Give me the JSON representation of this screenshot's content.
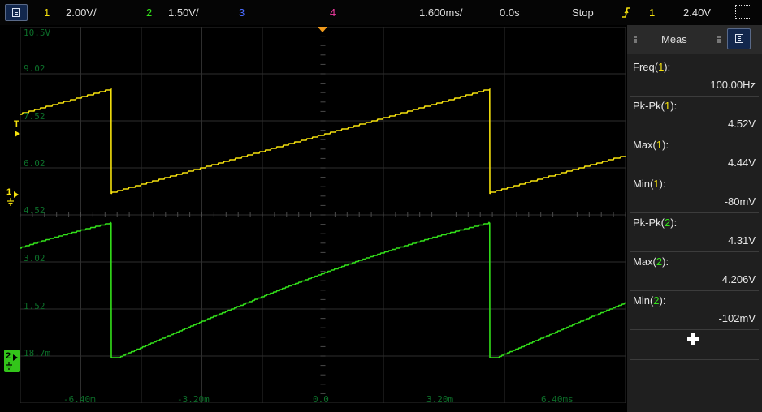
{
  "topbar": {
    "ch1_num": "1",
    "ch1_scale": "2.00V/",
    "ch2_num": "2",
    "ch2_scale": "1.50V/",
    "ch3_num": "3",
    "ch4_num": "4",
    "timebase": "1.600ms/",
    "delay": "0.0s",
    "run_state": "Stop",
    "trigger_source": "1",
    "trigger_level": "2.40V"
  },
  "colors": {
    "ch1": "#f5e10d",
    "ch2": "#33e11a",
    "ch3": "#4a6cff",
    "ch4": "#f03aa0",
    "grid": "#2e2e2e",
    "graticule_text": "#0c6e29"
  },
  "icons": [
    "menu-icon",
    "trigger-edge-icon",
    "fit-window-icon",
    "ground-icon",
    "plus-icon"
  ],
  "graticule": {
    "y_labels": [
      "10.5V",
      "9.02",
      "7.52",
      "6.02",
      "4.52",
      "3.02",
      "1.52",
      "18.7m"
    ],
    "x_labels": [
      "-6.40m",
      "-3.20m",
      "0.0",
      "3.20m",
      "6.40ms"
    ],
    "trigger_marker": "T",
    "ch1_marker": "1",
    "ch2_marker": "2"
  },
  "panel": {
    "title": "Meas",
    "measurements": [
      {
        "label": "Freq(",
        "ch": "1",
        "tail": "):",
        "value": "100.00Hz"
      },
      {
        "label": "Pk-Pk(",
        "ch": "1",
        "tail": "):",
        "value": "4.52V"
      },
      {
        "label": "Max(",
        "ch": "1",
        "tail": "):",
        "value": "4.44V"
      },
      {
        "label": "Min(",
        "ch": "1",
        "tail": "):",
        "value": "-80mV"
      },
      {
        "label": "Pk-Pk(",
        "ch": "2",
        "tail": "):",
        "value": "4.31V"
      },
      {
        "label": "Max(",
        "ch": "2",
        "tail": "):",
        "value": "4.206V"
      },
      {
        "label": "Min(",
        "ch": "2",
        "tail": "):",
        "value": "-102mV"
      }
    ]
  }
}
